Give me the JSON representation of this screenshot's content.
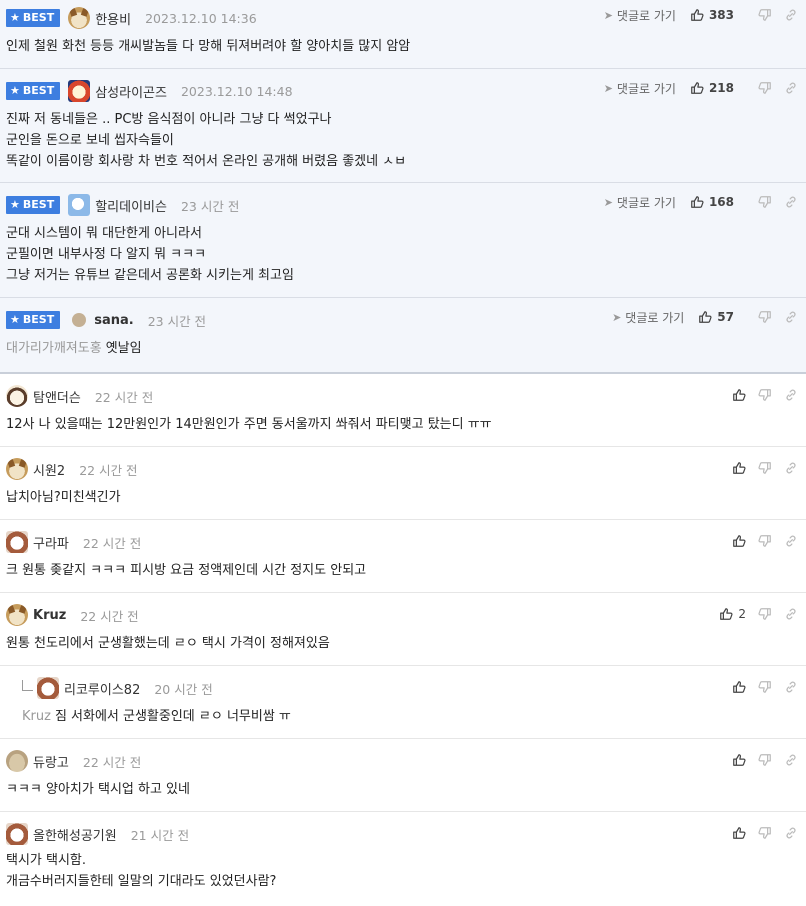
{
  "best_label": "BEST",
  "goto_label": "댓글로 가기",
  "best": [
    {
      "nick": "한용비",
      "date": "2023.12.10 14:36",
      "likes": "383",
      "lines": [
        "인제 철원 화천 등등 개씨발놈들 다 망해 뒤져버려야 할 양아치들 많지 암암"
      ]
    },
    {
      "nick": "삼성라이곤즈",
      "date": "2023.12.10 14:48",
      "likes": "218",
      "lines": [
        "진짜 저 동네들은 .. PC방 음식점이 아니라 그냥 다 썩었구나",
        "군인을 돈으로 보네 씹자슥들이",
        "똑같이 이름이랑 회사랑 차 번호 적어서 온라인 공개해 버렸음 좋겠네 ㅅㅂ"
      ]
    },
    {
      "nick": "할리데이비슨",
      "date": "23 시간 전",
      "likes": "168",
      "lines": [
        "군대 시스템이 뭐 대단한게 아니라서",
        "군필이면 내부사정 다 알지 뭐 ㅋㅋㅋ",
        "그냥 저거는 유튜브 같은데서 공론화 시키는게 최고임"
      ]
    },
    {
      "nick": "sana.",
      "date": "23 시간 전",
      "likes": "57",
      "mention": "대가리가깨져도홍",
      "lines": [
        "옛날임"
      ]
    }
  ],
  "comments": [
    {
      "nick": "탐앤더슨",
      "date": "22 시간 전",
      "likes": "",
      "lines": [
        "12사 나 있을때는 12만원인가 14만원인가 주면 동서울까지 쏴줘서 파티맺고 탔는디 ㅠㅠ"
      ]
    },
    {
      "nick": "시원2",
      "date": "22 시간 전",
      "likes": "",
      "lines": [
        "납치아님?미친색긴가"
      ]
    },
    {
      "nick": "구라파",
      "date": "22 시간 전",
      "likes": "",
      "lines": [
        "크 원통 좆같지 ㅋㅋㅋ 피시방 요금 정액제인데 시간 정지도 안되고"
      ]
    },
    {
      "nick": "Kruz",
      "date": "22 시간 전",
      "likes": "2",
      "lines": [
        "원통 천도리에서 군생활했는데 ㄹㅇ 택시 가격이 정해져있음"
      ]
    },
    {
      "nick": "리코루이스82",
      "date": "20 시간 전",
      "likes": "",
      "mention": "Kruz",
      "lines": [
        "짐 서화에서 군생활중인데 ㄹㅇ 너무비쌈 ㅠ"
      ]
    },
    {
      "nick": "듀랑고",
      "date": "22 시간 전",
      "likes": "",
      "lines": [
        "ㅋㅋㅋ 양아치가 택시업 하고 있네"
      ]
    },
    {
      "nick": "올한해성공기원",
      "date": "21 시간 전",
      "likes": "",
      "lines": [
        "택시가 택시함.",
        "개금수버러지들한테 일말의 기대라도 있었던사람?"
      ]
    }
  ]
}
